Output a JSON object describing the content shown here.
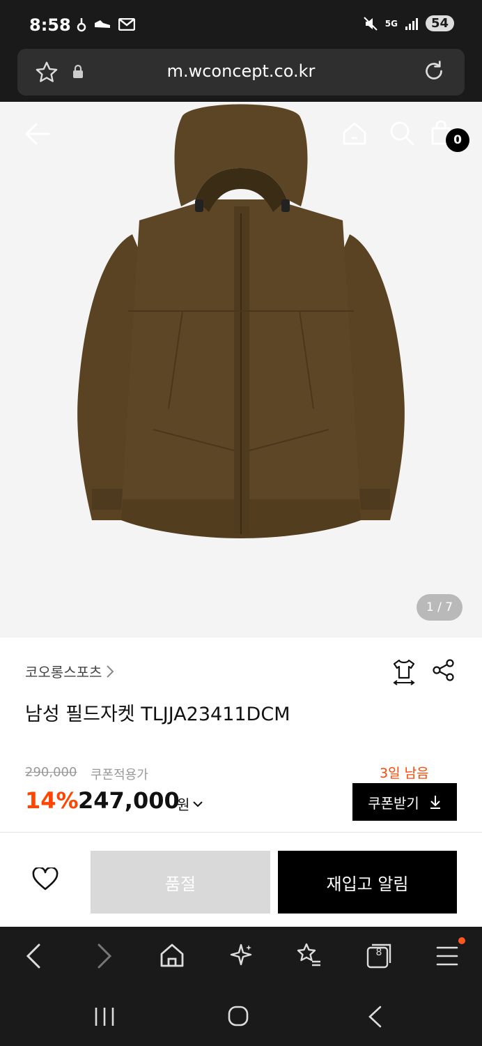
{
  "status": {
    "time": "8:58",
    "battery": "54",
    "network": "5G"
  },
  "browser": {
    "url": "m.wconcept.co.kr",
    "tabs_count": "8"
  },
  "hero": {
    "cart_count": "0",
    "image_counter": "1 / 7"
  },
  "product": {
    "brand": "코오롱스포츠",
    "name": "남성 필드자켓 TLJJA23411DCM",
    "original_price": "290,000",
    "coupon_label": "쿠폰적용가",
    "discount": "14%",
    "price": "247,000",
    "currency": "원",
    "days_left": "3일 남음",
    "coupon_button": "쿠폰받기"
  },
  "actions": {
    "soldout": "품절",
    "restock": "재입고 알림"
  },
  "colors": {
    "accent": "#ff4500",
    "jacket": "#5b4424",
    "black": "#000000"
  }
}
